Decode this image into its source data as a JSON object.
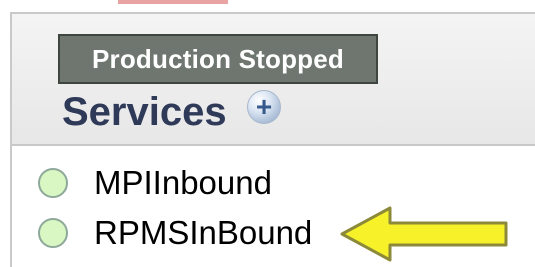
{
  "status": {
    "badge_text": "Production Stopped",
    "badge_color": "#6f766f"
  },
  "services_panel": {
    "title": "Services",
    "add_icon": "plus-icon"
  },
  "services": [
    {
      "name": "MPIInbound",
      "status_color": "#d9f7c2"
    },
    {
      "name": "RPMSInBound",
      "status_color": "#d9f7c2"
    }
  ],
  "annotation": {
    "arrow_color": "#f7f12a",
    "target": "RPMSInBound"
  }
}
